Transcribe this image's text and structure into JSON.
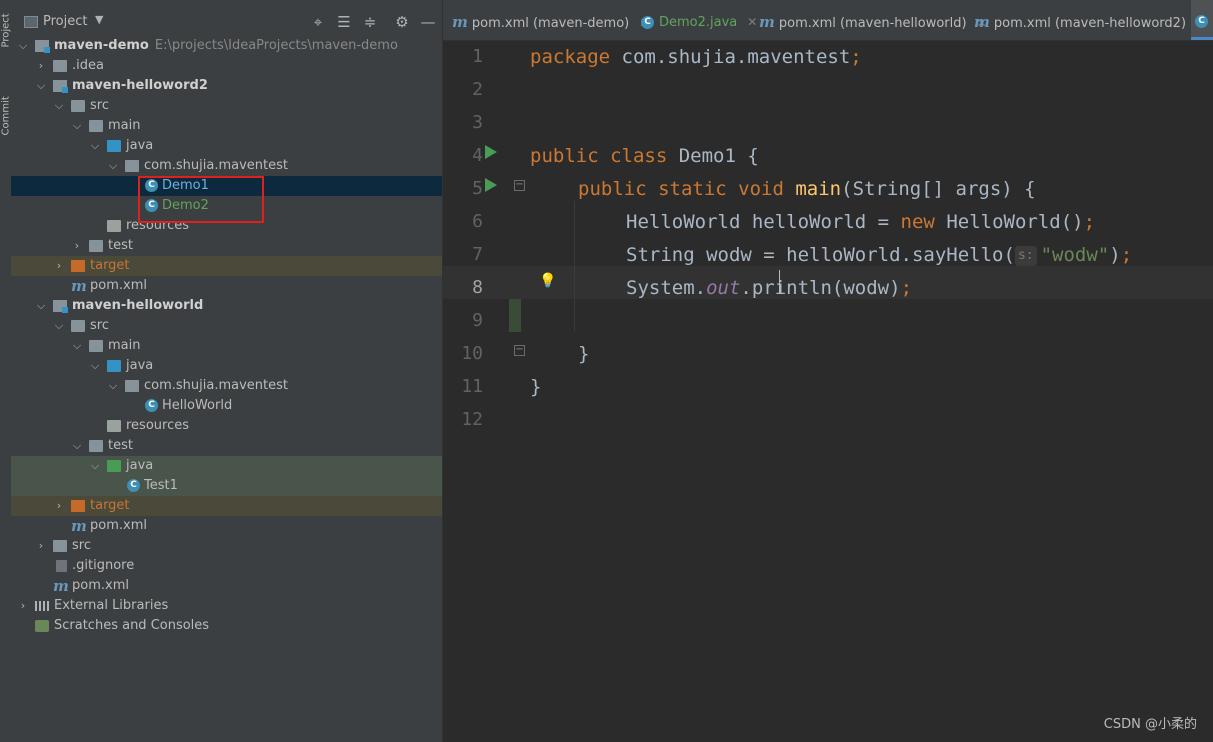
{
  "side_tabs": [
    "Project",
    "Commit"
  ],
  "project_panel": {
    "title": "Project",
    "toolbar_icons": [
      "crosshair-icon",
      "expand-all-icon",
      "collapse-all-icon",
      "gear-icon",
      "minimize-icon"
    ]
  },
  "tree": [
    {
      "label": "maven-demo",
      "path": "E:\\projects\\IdeaProjects\\maven-demo",
      "icon": "module-folder-icon"
    },
    {
      "label": ".idea",
      "icon": "folder-icon"
    },
    {
      "label": "maven-helloword2",
      "icon": "module-folder-icon"
    },
    {
      "label": "src",
      "icon": "folder-icon"
    },
    {
      "label": "main",
      "icon": "folder-icon"
    },
    {
      "label": "java",
      "icon": "source-folder-icon"
    },
    {
      "label": "com.shujia.maventest",
      "icon": "package-icon"
    },
    {
      "label": "Demo1",
      "icon": "java-class-icon"
    },
    {
      "label": "Demo2",
      "icon": "java-class-icon"
    },
    {
      "label": "resources",
      "icon": "resources-folder-icon"
    },
    {
      "label": "test",
      "icon": "folder-icon"
    },
    {
      "label": "target",
      "icon": "excluded-folder-icon"
    },
    {
      "label": "pom.xml",
      "icon": "maven-icon"
    },
    {
      "label": "maven-helloworld",
      "icon": "module-folder-icon"
    },
    {
      "label": "src",
      "icon": "folder-icon"
    },
    {
      "label": "main",
      "icon": "folder-icon"
    },
    {
      "label": "java",
      "icon": "source-folder-icon"
    },
    {
      "label": "com.shujia.maventest",
      "icon": "package-icon"
    },
    {
      "label": "HelloWorld",
      "icon": "java-class-icon"
    },
    {
      "label": "resources",
      "icon": "resources-folder-icon"
    },
    {
      "label": "test",
      "icon": "folder-icon"
    },
    {
      "label": "java",
      "icon": "test-source-folder-icon"
    },
    {
      "label": "Test1",
      "icon": "java-class-icon"
    },
    {
      "label": "target",
      "icon": "excluded-folder-icon"
    },
    {
      "label": "pom.xml",
      "icon": "maven-icon"
    },
    {
      "label": "src",
      "icon": "folder-icon"
    },
    {
      "label": ".gitignore",
      "icon": "gitignore-icon"
    },
    {
      "label": "pom.xml",
      "icon": "maven-icon"
    },
    {
      "label": "External Libraries",
      "icon": "library-icon"
    },
    {
      "label": "Scratches and Consoles",
      "icon": "scratches-icon"
    }
  ],
  "tabs": [
    {
      "label": "pom.xml (maven-demo)",
      "icon": "maven-icon"
    },
    {
      "label": "Demo2.java",
      "icon": "java-class-icon"
    },
    {
      "label": "pom.xml (maven-helloworld)",
      "icon": "maven-icon"
    },
    {
      "label": "pom.xml (maven-helloword2)",
      "icon": "maven-icon"
    }
  ],
  "editor": {
    "line_numbers": [
      "1",
      "2",
      "3",
      "4",
      "5",
      "6",
      "7",
      "8",
      "9",
      "10",
      "11",
      "12"
    ],
    "current_line": "8",
    "code": {
      "l1_kw": "package",
      "l1_rest": " com.shujia.maventest",
      "l1_semi": ";",
      "l4_kw": "public class",
      "l4_rest": " Demo1 {",
      "l5_kw": "public static void",
      "l5_fn": "main",
      "l5_rest": "(String[] args) {",
      "l6_a": "HelloWorld helloWorld = ",
      "l6_kw": "new",
      "l6_b": " HelloWorld()",
      "l6_semi": ";",
      "l7_a": "String wodw = helloWorld.sayHello(",
      "l7_hint": "s:",
      "l7_str": "\"wodw\"",
      "l7_b": ")",
      "l7_semi": ";",
      "l8_a": "System.",
      "l8_fld": "out",
      "l8_b": ".println(wodw)",
      "l8_semi": ";",
      "l10": "}",
      "l11": "}"
    }
  },
  "watermark": "CSDN @小柔的"
}
